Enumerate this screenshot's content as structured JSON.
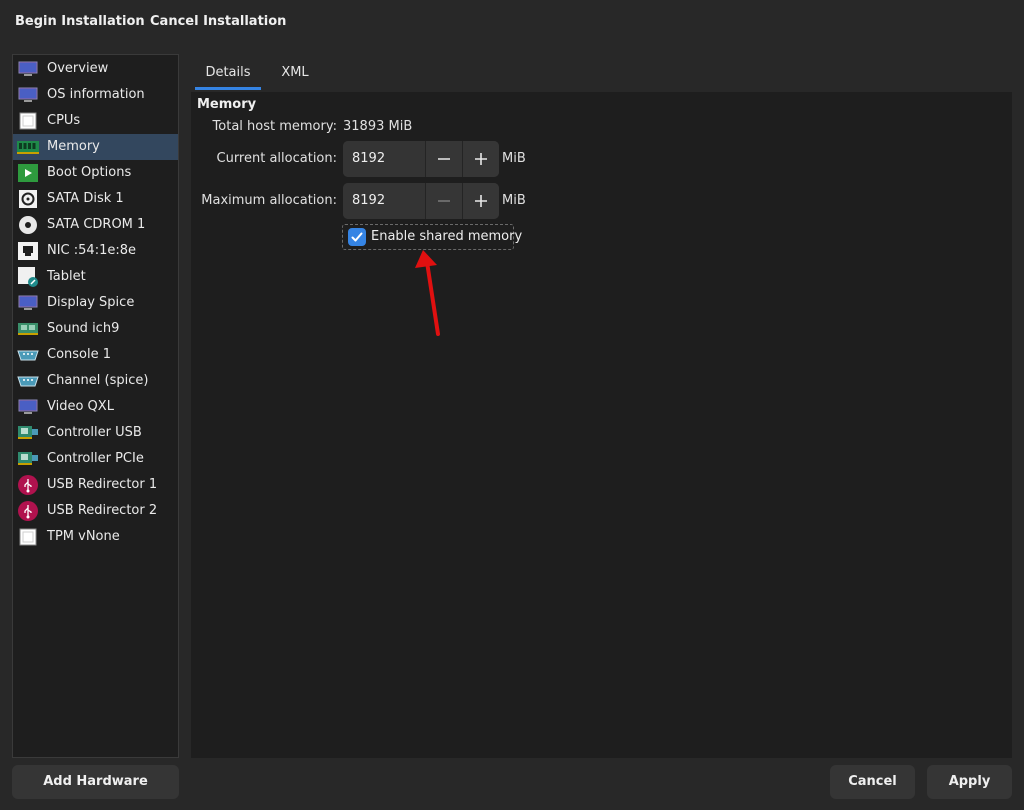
{
  "toolbar": {
    "begin_label": "Begin Installation",
    "cancel_label": "Cancel Installation"
  },
  "sidebar": {
    "selected_index": 3,
    "items": [
      {
        "label": "Overview",
        "icon": "monitor-icon"
      },
      {
        "label": "OS information",
        "icon": "monitor-icon"
      },
      {
        "label": "CPUs",
        "icon": "chip-icon"
      },
      {
        "label": "Memory",
        "icon": "ram-icon"
      },
      {
        "label": "Boot Options",
        "icon": "play-icon"
      },
      {
        "label": "SATA Disk 1",
        "icon": "disk-icon"
      },
      {
        "label": "SATA CDROM 1",
        "icon": "cdrom-icon"
      },
      {
        "label": "NIC :54:1e:8e",
        "icon": "network-port-icon"
      },
      {
        "label": "Tablet",
        "icon": "tablet-icon"
      },
      {
        "label": "Display Spice",
        "icon": "monitor-icon"
      },
      {
        "label": "Sound ich9",
        "icon": "sound-card-icon"
      },
      {
        "label": "Console 1",
        "icon": "serial-port-icon"
      },
      {
        "label": "Channel (spice)",
        "icon": "serial-port-icon"
      },
      {
        "label": "Video QXL",
        "icon": "monitor-icon"
      },
      {
        "label": "Controller USB",
        "icon": "controller-card-icon"
      },
      {
        "label": "Controller PCIe",
        "icon": "controller-card-icon"
      },
      {
        "label": "USB Redirector 1",
        "icon": "usb-icon"
      },
      {
        "label": "USB Redirector 2",
        "icon": "usb-icon"
      },
      {
        "label": "TPM vNone",
        "icon": "chip-icon"
      }
    ],
    "add_hardware_label": "Add Hardware"
  },
  "tabs": [
    {
      "label": "Details",
      "active": true
    },
    {
      "label": "XML",
      "active": false
    }
  ],
  "memory": {
    "section_title": "Memory",
    "total_label": "Total host memory:",
    "total_value": "31893 MiB",
    "current_label": "Current allocation:",
    "current_value": "8192",
    "max_label": "Maximum allocation:",
    "max_value": "8192",
    "unit": "MiB",
    "shared_label": "Enable shared memory",
    "shared_checked": true
  },
  "footer": {
    "cancel_label": "Cancel",
    "apply_label": "Apply"
  },
  "colors": {
    "accent": "#3584e4",
    "selected_row": "#33475e",
    "annotation_arrow": "#e01010"
  }
}
